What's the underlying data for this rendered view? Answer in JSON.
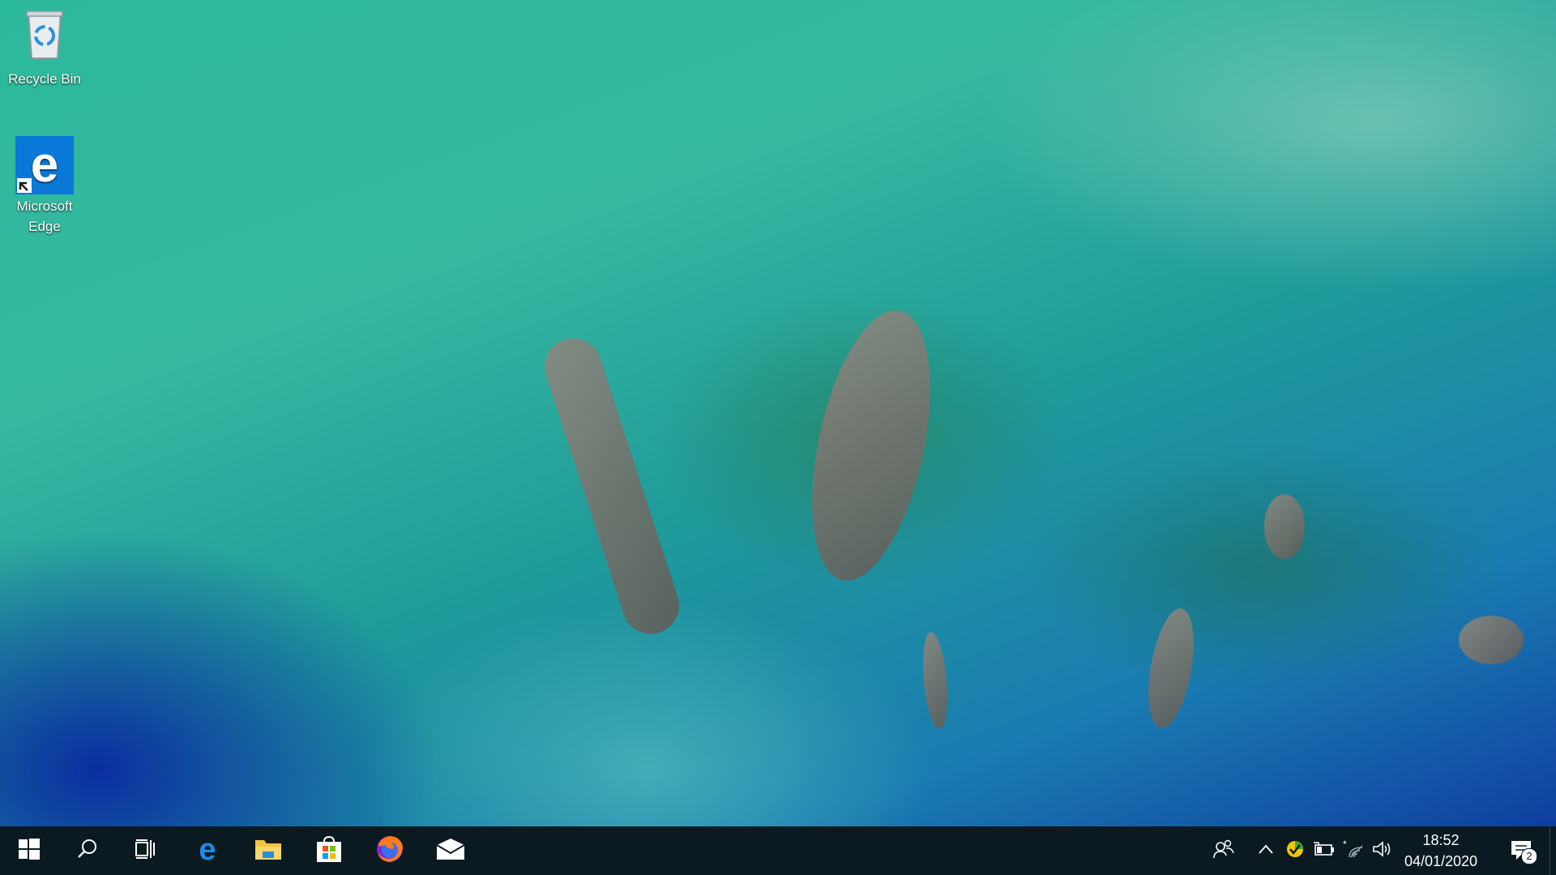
{
  "desktop": {
    "icons": [
      {
        "label": "Recycle Bin",
        "icon": "recycle-bin-icon"
      },
      {
        "label": "Microsoft Edge",
        "icon": "edge-icon"
      }
    ]
  },
  "taskbar": {
    "start": {
      "icon": "windows-logo-icon"
    },
    "search": {
      "icon": "search-icon"
    },
    "task_view": {
      "icon": "task-view-icon"
    },
    "pinned": [
      {
        "name": "Microsoft Edge",
        "icon": "edge-icon"
      },
      {
        "name": "File Explorer",
        "icon": "folder-icon"
      },
      {
        "name": "Microsoft Store",
        "icon": "store-icon"
      },
      {
        "name": "Firefox",
        "icon": "firefox-icon"
      },
      {
        "name": "Mail",
        "icon": "mail-icon"
      }
    ],
    "tray": {
      "icons": [
        "people-icon",
        "chevron-up-icon",
        "security-shield-icon",
        "battery-icon",
        "wifi-icon",
        "volume-icon"
      ],
      "time": "18:52",
      "date": "04/01/2020",
      "notification_count": "2"
    }
  },
  "colors": {
    "taskbar_bg": "#0b1a20",
    "edge_blue": "#0a78d7",
    "folder_yellow": "#f2c343",
    "firefox_orange": "#ff7a1a"
  }
}
